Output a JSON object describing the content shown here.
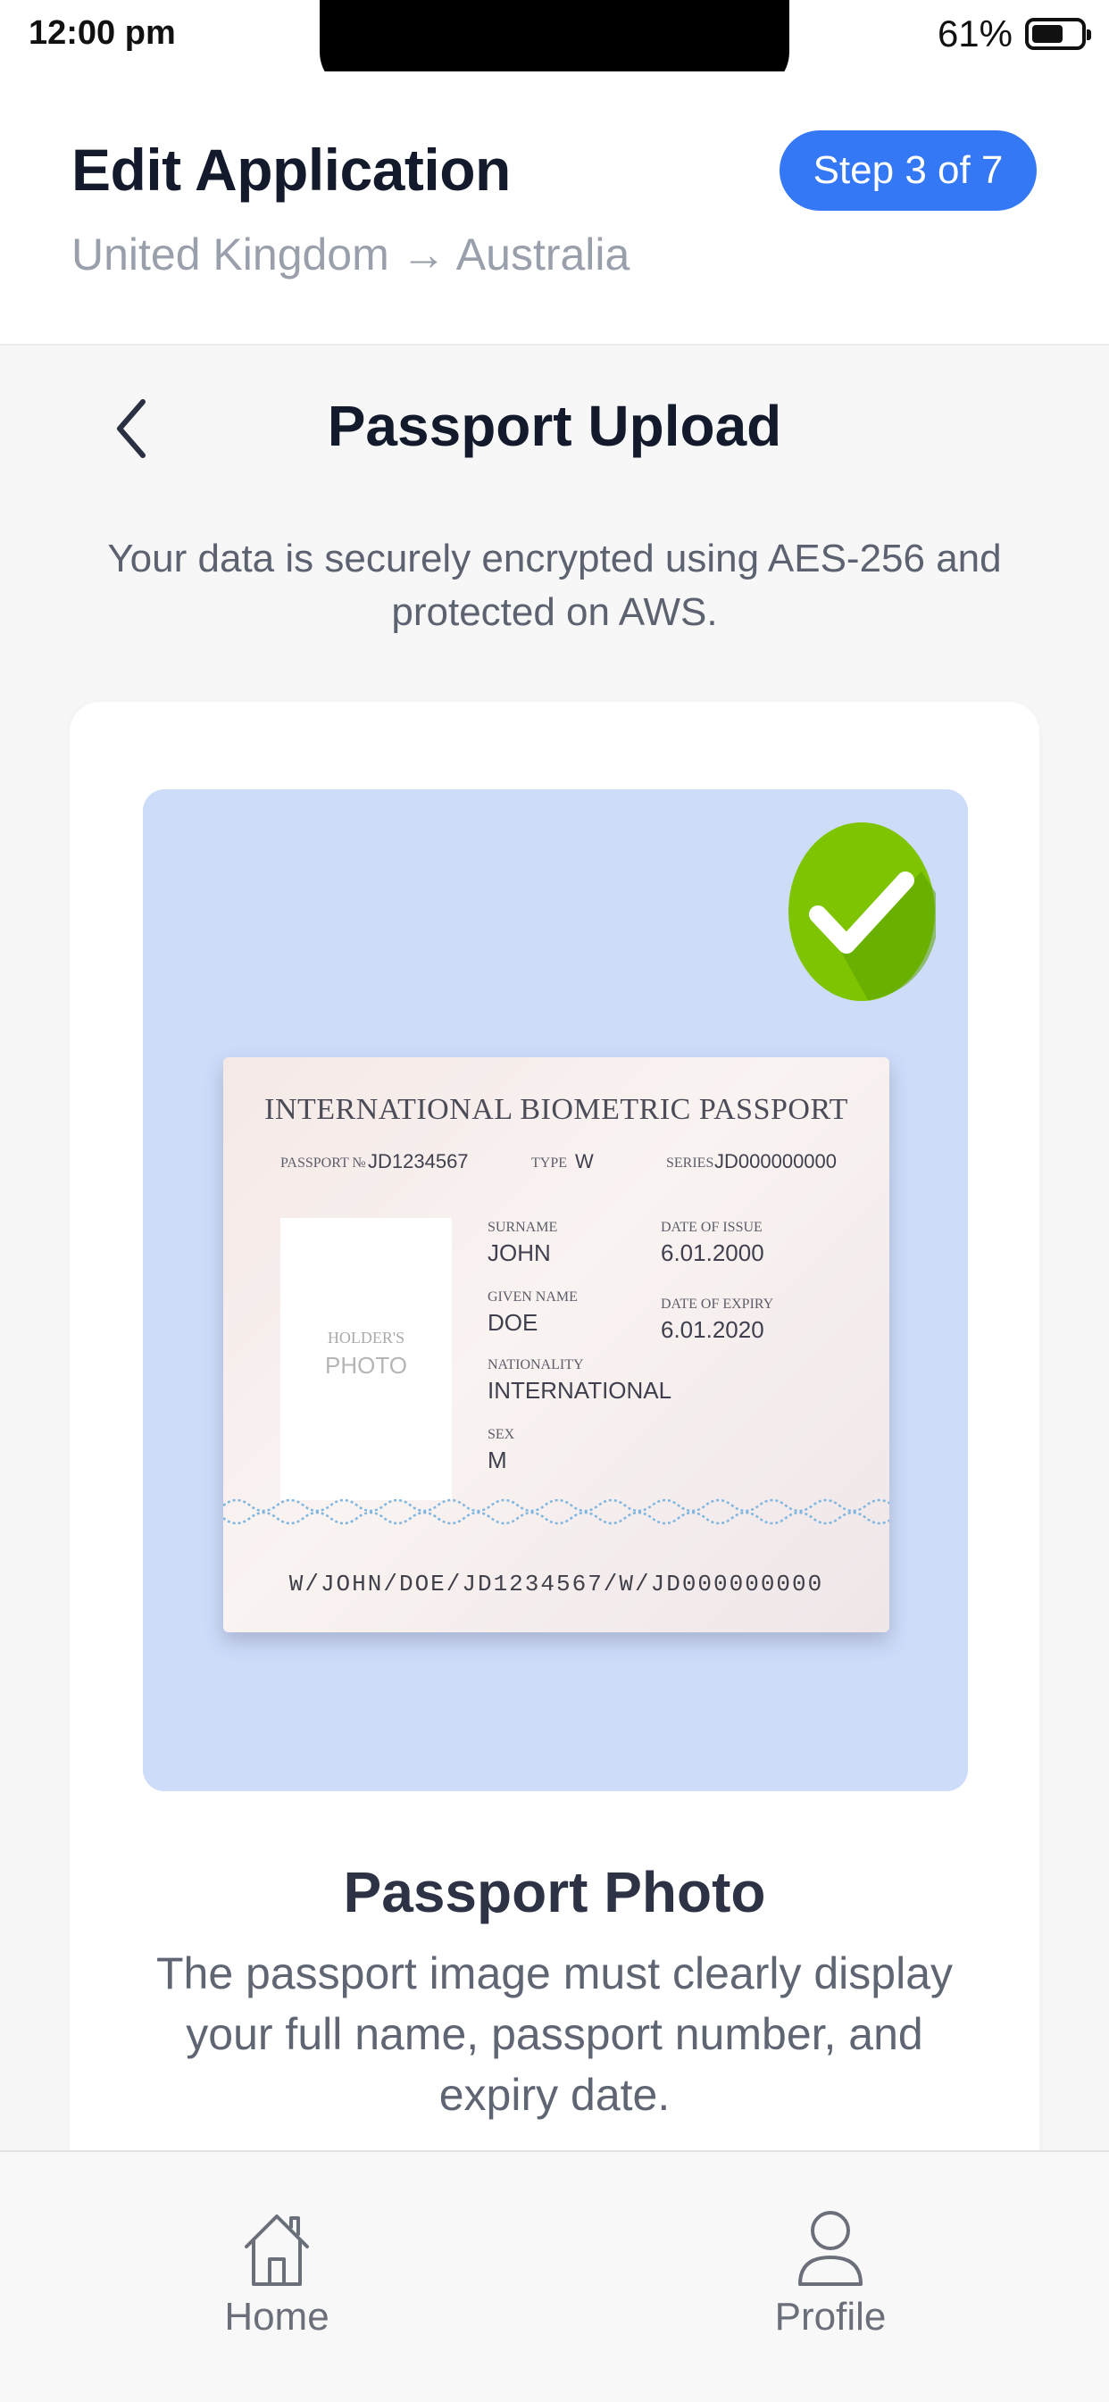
{
  "status_bar": {
    "time": "12:00 pm",
    "battery": "61%"
  },
  "header": {
    "title": "Edit Application",
    "route": "United Kingdom → Australia",
    "step_badge": "Step 3 of 7"
  },
  "page": {
    "title": "Passport Upload",
    "security_note": "Your data is securely encrypted using AES-256 and protected on AWS."
  },
  "passport": {
    "heading": "INTERNATIONAL BIOMETRIC PASSPORT",
    "passport_no_label": "PASSPORT №",
    "passport_no": "JD1234567",
    "type_label": "TYPE",
    "type": "W",
    "series_label": "SERIES",
    "series": "JD000000000",
    "surname_label": "SURNAME",
    "surname": "JOHN",
    "given_name_label": "GIVEN NAME",
    "given_name": "DOE",
    "nationality_label": "NATIONALITY",
    "nationality": "INTERNATIONAL",
    "sex_label": "SEX",
    "sex": "M",
    "issue_label": "DATE OF ISSUE",
    "issue": "6.01.2000",
    "expiry_label": "DATE OF EXPIRY",
    "expiry": "6.01.2020",
    "photo_label_1": "HOLDER'S",
    "photo_label_2": "PHOTO",
    "mrz": "W/JOHN/DOE/JD1234567/W/JD000000000"
  },
  "card": {
    "title": "Passport Photo",
    "description": "The passport image must clearly display your full name, passport number, and expiry date."
  },
  "tab_bar": {
    "home": "Home",
    "profile": "Profile"
  },
  "colors": {
    "accent": "#3478f6",
    "success": "#7ec400",
    "preview_bg": "#cddcf9"
  },
  "icons": {
    "back": "chevron-left-icon",
    "check": "checkmark-icon",
    "home": "home-icon",
    "profile": "person-icon"
  }
}
